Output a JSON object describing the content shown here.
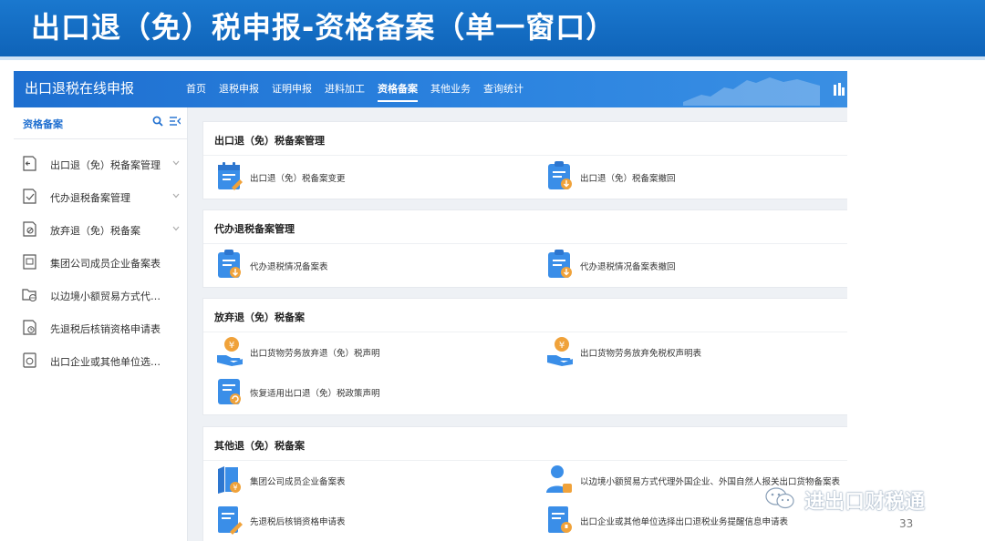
{
  "slide": {
    "title": "出口退（免）税申报-资格备案（单一窗口）",
    "page_number": "33",
    "watermark": "进出口财税通"
  },
  "app": {
    "title": "出口退税在线申报",
    "nav": [
      "首页",
      "退税申报",
      "证明申报",
      "进料加工",
      "资格备案",
      "其他业务",
      "查询统计"
    ],
    "active_nav": "资格备案"
  },
  "sidebar": {
    "title": "资格备案",
    "items": [
      {
        "label": "出口退（免）税备案管理",
        "icon": "doc-arrow-icon",
        "expandable": true
      },
      {
        "label": "代办退税备案管理",
        "icon": "doc-check-icon",
        "expandable": true
      },
      {
        "label": "放弃退（免）税备案",
        "icon": "doc-cancel-icon",
        "expandable": true
      },
      {
        "label": "集团公司成员企业备案表",
        "icon": "doc-image-icon",
        "expandable": false
      },
      {
        "label": "以边境小额贸易方式代…",
        "icon": "folder-globe-icon",
        "expandable": false
      },
      {
        "label": "先退税后核销资格申请表",
        "icon": "doc-clock-icon",
        "expandable": false
      },
      {
        "label": "出口企业或其他单位选…",
        "icon": "doc-cycle-icon",
        "expandable": false
      }
    ]
  },
  "sections": [
    {
      "title": "出口退（免）税备案管理",
      "entries": [
        {
          "label": "出口退（免）税备案变更",
          "icon": "calendar-edit-icon"
        },
        {
          "label": "出口退（免）税备案撤回",
          "icon": "clipboard-withdraw-icon"
        }
      ]
    },
    {
      "title": "代办退税备案管理",
      "entries": [
        {
          "label": "代办退税情况备案表",
          "icon": "clipboard-download-icon"
        },
        {
          "label": "代办退税情况备案表撤回",
          "icon": "clipboard-withdraw-icon"
        }
      ]
    },
    {
      "title": "放弃退（免）税备案",
      "entries": [
        {
          "label": "出口货物劳务放弃退（免）税声明",
          "icon": "hand-yuan-icon"
        },
        {
          "label": "出口货物劳务放弃免税权声明表",
          "icon": "hand-yuan-icon"
        },
        {
          "label": "恢复适用出口退（免）税政策声明",
          "icon": "clipboard-refresh-icon"
        }
      ]
    },
    {
      "title": "其他退（免）税备案",
      "entries": [
        {
          "label": "集团公司成员企业备案表",
          "icon": "books-yuan-icon"
        },
        {
          "label": "以边境小额贸易方式代理外国企业、外国自然人报关出口货物备案表",
          "icon": "person-yuan-icon"
        },
        {
          "label": "先退税后核销资格申请表",
          "icon": "doc-pencil-icon"
        },
        {
          "label": "出口企业或其他单位选择出口退税业务提醒信息申请表",
          "icon": "doc-bell-icon"
        }
      ]
    }
  ],
  "colors": {
    "banner": "#1a78cf",
    "topbar": "#2c84e0",
    "accent": "#1f6fd0",
    "icon_blue": "#3a8ee8",
    "icon_orange": "#f0a23a"
  }
}
